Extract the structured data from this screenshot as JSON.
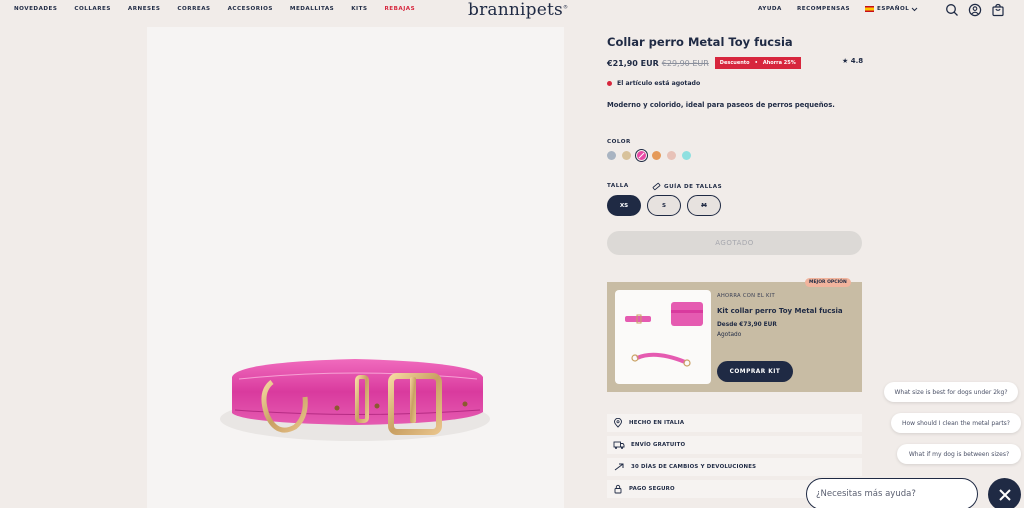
{
  "header": {
    "nav": [
      "NOVEDADES",
      "COLLARES",
      "ARNESES",
      "CORREAS",
      "ACCESORIOS",
      "MEDALLITAS",
      "KITS",
      "REBAJAS"
    ],
    "logo": "brannipets",
    "help": "AYUDA",
    "rewards": "RECOMPENSAS",
    "language": "ESPAÑOL",
    "icons": [
      "search-icon",
      "account-icon",
      "bag-icon"
    ]
  },
  "product": {
    "title": "Collar perro Metal Toy fucsia",
    "price": "€21,90 EUR",
    "old_price": "€29,90 EUR",
    "discount_label": "Descuento",
    "discount_save": "Ahorra 25%",
    "rating": "4.8",
    "stock_status": "El artículo está agotado",
    "description": "Moderno y colorido, ideal para paseos de perros pequeños.",
    "color_label": "COLOR",
    "colors": [
      "#a9b4c2",
      "#d8c29b",
      "#e84aa6",
      "#e59a5a",
      "#e8c2b8",
      "#8fe0e0"
    ],
    "size_label": "TALLA",
    "size_guide": "GUÍA DE TALLAS",
    "sizes": [
      "XS",
      "S",
      "M"
    ],
    "sold_out_button": "AGOTADO"
  },
  "kit": {
    "badge": "MEJOR OPCIÓN",
    "subtitle": "AHORRA CON EL KIT",
    "title": "Kit collar perro Toy Metal fucsia",
    "price": "Desde €73,90 EUR",
    "stock": "Agotado",
    "button": "COMPRAR KIT"
  },
  "features": [
    {
      "icon": "location-pin-icon",
      "label": "HECHO EN ITALIA"
    },
    {
      "icon": "delivery-truck-icon",
      "label": "ENVÍO GRATUITO"
    },
    {
      "icon": "return-arrow-icon",
      "label": "30 DÍAS DE CAMBIOS Y DEVOLUCIONES"
    },
    {
      "icon": "lock-icon",
      "label": "PAGO SEGURO"
    }
  ],
  "chat": {
    "suggestions": [
      "What size is best for dogs under 2kg?",
      "How should I clean the metal parts?",
      "What if my dog is between sizes?"
    ],
    "placeholder": "¿Necesitas más ayuda?"
  },
  "colors": {
    "navy": "#1f2a44",
    "sale_red": "#d7263d",
    "background": "#f1ece9",
    "kit_background": "#c8bca4",
    "collar_pink": "#e84aa6"
  }
}
